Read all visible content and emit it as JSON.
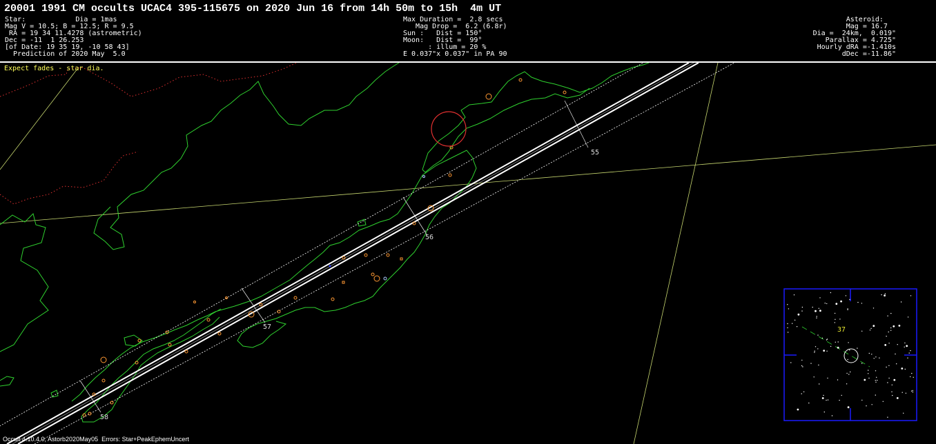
{
  "title": "20001 1991 CM occults UCAC4 395-115675 on 2020 Jun 16 from 14h 50m to 15h  4m UT",
  "star_block": [
    "Star:            Dia = 1mas",
    "Mag V = 10.5; B = 12.5; R = 9.5",
    " RA = 19 34 11.4278 (astrometric)",
    "Dec = -11  1 26.253",
    "[of Date: 19 35 19, -10 58 43]",
    "  Prediction of 2020 May  5.0"
  ],
  "event_block": [
    "Max Duration =  2.8 secs",
    "   Mag Drop =  6.2 (6.8r)",
    "Sun :   Dist = 150°",
    "Moon:   Dist =  99°",
    "      : illum = 20 %",
    "E 0.037\"x 0.037\" in PA 90"
  ],
  "asteroid_block": [
    "Asteroid:   ",
    "Mag = 16.7  ",
    "Dia =  24km,  0.019\"",
    "Parallax = 4.725\"",
    "Hourly dRA =-1.410s",
    "dDec =-11.86\""
  ],
  "note": "Expect fades - star dia.",
  "footer": "Occult 4.10.4.0, Astorb2020May05  Errors: Star+PeakEphemUncert",
  "minute_labels": [
    "55",
    "56",
    "57",
    "58"
  ],
  "inset_label": "37",
  "colors": {
    "background": "#000000",
    "text": "#ffffff",
    "note": "#ffff5a",
    "coastline": "#2fd12f",
    "border": "#e03030",
    "grid": "#c8d870",
    "path": "#ffffff",
    "city": "#ff9933",
    "inset_frame": "#1a1aff"
  }
}
